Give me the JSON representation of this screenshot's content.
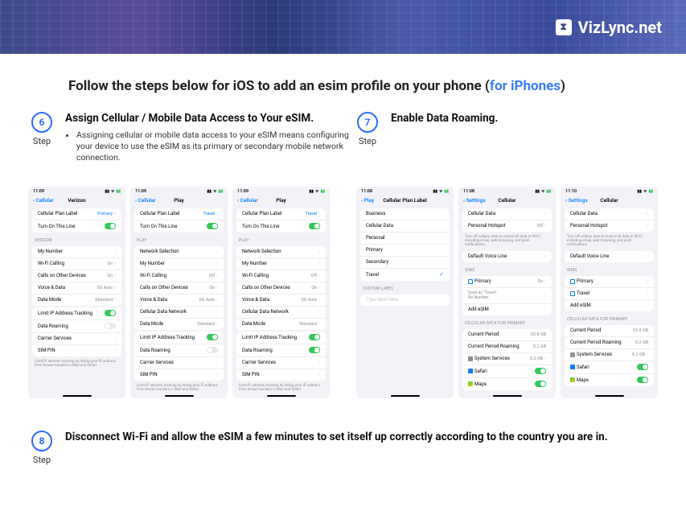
{
  "brand": "VizLync.net",
  "headline_prefix": "Follow the steps below for iOS to add an esim profile on your phone (",
  "headline_link": "for iPhones",
  "headline_suffix": ")",
  "step_label": "Step",
  "step6": {
    "num": "6",
    "title": "Assign Cellular / Mobile Data Access to Your eSIM.",
    "bullet": "Assigning cellular or mobile data access to your eSIM means configuring your device to use the eSIM as its primary or secondary mobile network connection."
  },
  "step7": {
    "num": "7",
    "title": "Enable Data Roaming."
  },
  "step8": {
    "num": "8",
    "title": "Disconnect Wi-Fi and allow the eSIM a few minutes to set itself up correctly according to the country you are in."
  },
  "phones": {
    "p1": {
      "time": "11:09",
      "back": "Cellular",
      "title": "Verizon",
      "r1": "Cellular Plan Label",
      "r1v": "Primary",
      "r2": "Turn On This Line",
      "hdr1": "VERIZON",
      "r3": "My Number",
      "r4": "Wi-Fi Calling",
      "r4v": "On",
      "r5": "Calls on Other Devices",
      "r5v": "On",
      "r6": "Voice & Data",
      "r6v": "5G Auto",
      "r7": "Data Mode",
      "r7v": "Standard",
      "r8": "Limit IP Address Tracking",
      "r9": "Data Roaming",
      "r10": "Carrier Services",
      "r11": "SIM PIN",
      "foot": "Limit IP address tracking by hiding your IP address from known trackers in Mail and Safari."
    },
    "p2": {
      "time": "11:09",
      "back": "Cellular",
      "title": "Play",
      "r1": "Cellular Plan Label",
      "r1v": "Travel",
      "r2": "Turn On This Line",
      "hdr1": "PLAY",
      "r3": "Network Selection",
      "r4": "My Number",
      "r5": "Wi-Fi Calling",
      "r5v": "Off",
      "r6": "Calls on Other Devices",
      "r6v": "On",
      "r7": "Voice & Data",
      "r7v": "5G Auto",
      "r8": "Cellular Data Network",
      "r9": "Data Mode",
      "r9v": "Standard",
      "r10": "Limit IP Address Tracking",
      "r11": "Data Roaming",
      "r12": "Carrier Services",
      "r13": "SIM PIN",
      "foot": "Limit IP address tracking by hiding your IP address from known trackers in Mail and Safari."
    },
    "p3": {
      "time": "11:09",
      "back": "Cellular",
      "title": "Play",
      "r1": "Cellular Plan Label",
      "r1v": "Travel",
      "r2": "Turn On This Line",
      "hdr1": "PLAY",
      "r3": "Network Selection",
      "r4": "My Number",
      "r5": "Wi-Fi Calling",
      "r5v": "Off",
      "r6": "Calls on Other Devices",
      "r6v": "On",
      "r7": "Voice & Data",
      "r7v": "5G Auto",
      "r8": "Cellular Data Network",
      "r9": "Data Mode",
      "r9v": "Standard",
      "r10": "Limit IP Address Tracking",
      "r11": "Data Roaming",
      "r12": "Carrier Services",
      "r13": "SIM PIN",
      "foot": "Limit IP address tracking by hiding your IP address from known trackers in Mail and Safari."
    },
    "p4": {
      "time": "11:08",
      "back": "Play",
      "title": "Cellular Plan Label",
      "o1": "Business",
      "o2": "Cellular Data",
      "o3": "Personal",
      "o4": "Primary",
      "o5": "Secondary",
      "o6": "Travel",
      "hdr": "CUSTOM LABEL",
      "placeholder": "Type label here"
    },
    "p5": {
      "time": "11:08",
      "back": "Settings",
      "title": "Cellular",
      "r1": "Cellular Data",
      "r2": "Personal Hotspot",
      "r2v": "Off",
      "foot1": "Turn off cellular data to restrict all data to Wi-Fi, including email, web browsing, and push notifications.",
      "r3": "Default Voice Line",
      "hdr1": "SIMS",
      "r4": "Primary",
      "r4v": "On",
      "r4b": "Used as \"Travel\"",
      "r4c": "No Number",
      "r5": "Add eSIM",
      "hdr2": "CELLULAR DATA FOR PRIMARY",
      "r6": "Current Period",
      "r6v": "53.8 GB",
      "r7": "Current Period Roaming",
      "r7v": "5.2 GB",
      "r8": "System Services",
      "r8v": "8.2 GB",
      "r9": "Safari",
      "r10": "Maps"
    },
    "p6": {
      "time": "11:10",
      "back": "Settings",
      "title": "Cellular",
      "r1": "Cellular Data",
      "r2": "Personal Hotspot",
      "foot1": "Turn off cellular data to restrict all data to Wi-Fi, including email, web browsing, and push notifications.",
      "r3": "Default Voice Line",
      "hdr1": "SIMS",
      "r4": "Primary",
      "r5": "Travel",
      "r6": "Add eSIM",
      "hdr2": "CELLULAR DATA FOR PRIMARY",
      "r7": "Current Period",
      "r7v": "53.8 GB",
      "r8": "Current Period Roaming",
      "r8v": "5.2 GB",
      "r9": "System Services",
      "r9v": "8.2 GB",
      "r10": "Safari",
      "r11": "Maps"
    }
  }
}
